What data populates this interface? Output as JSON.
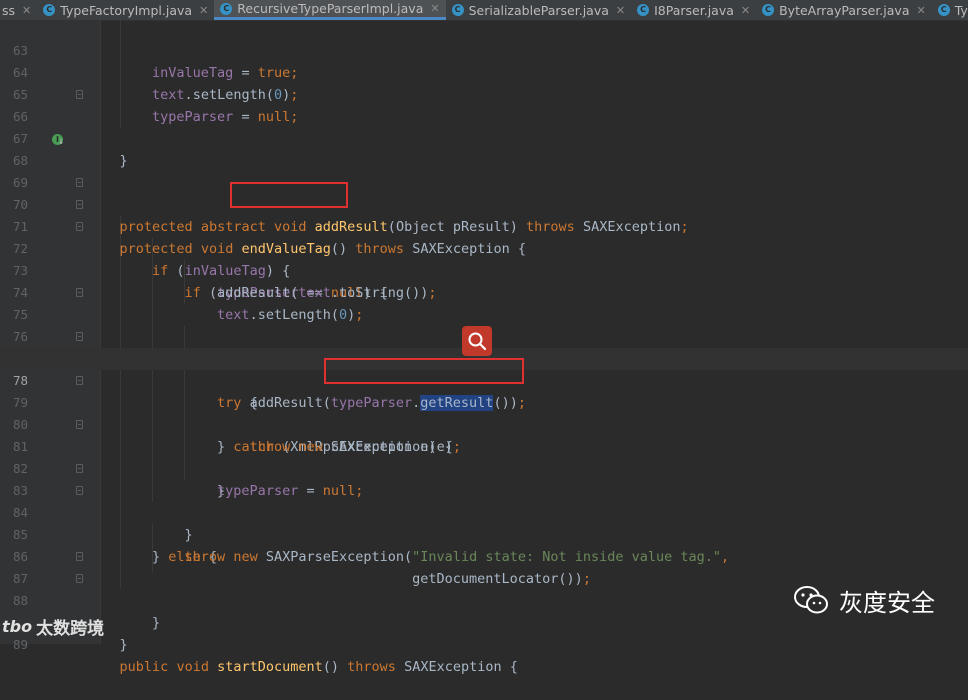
{
  "tabs": [
    {
      "label": "ss",
      "icon": "",
      "active": false
    },
    {
      "label": "TypeFactoryImpl.java",
      "icon": "C",
      "active": false
    },
    {
      "label": "RecursiveTypeParserImpl.java",
      "icon": "C",
      "active": true
    },
    {
      "label": "SerializableParser.java",
      "icon": "C",
      "active": false
    },
    {
      "label": "I8Parser.java",
      "icon": "C",
      "active": false
    },
    {
      "label": "ByteArrayParser.java",
      "icon": "C",
      "active": false
    },
    {
      "label": "TypeP",
      "icon": "C",
      "active": false
    }
  ],
  "editor": {
    "current_line": "78",
    "selected_text": "getResult",
    "lines": [
      {
        "num": "63"
      },
      {
        "num": "64"
      },
      {
        "num": "65"
      },
      {
        "num": "66"
      },
      {
        "num": "67"
      },
      {
        "num": "68"
      },
      {
        "num": "69"
      },
      {
        "num": "70"
      },
      {
        "num": "71"
      },
      {
        "num": "72"
      },
      {
        "num": "73"
      },
      {
        "num": "74"
      },
      {
        "num": "75"
      },
      {
        "num": "76"
      },
      {
        "num": "77"
      },
      {
        "num": "78"
      },
      {
        "num": "79"
      },
      {
        "num": "80"
      },
      {
        "num": "81"
      },
      {
        "num": "82"
      },
      {
        "num": "83"
      },
      {
        "num": "84"
      },
      {
        "num": "85"
      },
      {
        "num": "86"
      },
      {
        "num": "87"
      },
      {
        "num": "88"
      },
      {
        "num": "89"
      }
    ],
    "code": {
      "inValueTag": "inValueTag",
      "true": "true",
      "text": "text",
      "setLength": "setLength",
      "zero": "0",
      "typeParser": "typeParser",
      "null": "null",
      "protected": "protected",
      "abstract": "abstract",
      "void": "void",
      "addResult": "addResult",
      "Object": "Object",
      "pResult": "pResult",
      "throws": "throws",
      "SAXException": "SAXException",
      "endValueTag": "endValueTag",
      "if": "if",
      "toString": "toString",
      "else": "else",
      "endDocument": "endDocument",
      "try": "try",
      "getResult": "getResult",
      "catch": "catch",
      "XmlRpcException": "XmlRpcException",
      "e": "e",
      "throw": "throw",
      "new": "new",
      "SAXParseException": "SAXParseException",
      "invalid_state_string": "\"Invalid state: Not inside value tag.\"",
      "getDocumentLocator": "getDocumentLocator",
      "public": "public",
      "startDocument": "startDocument"
    }
  },
  "watermarks": {
    "left": "太数跨境",
    "left_logo": "tbo",
    "right": "灰度安全",
    "right_icon": "wechat-icon"
  },
  "colors": {
    "keyword": "#cc7832",
    "field": "#9876aa",
    "method": "#ffc66d",
    "number": "#6897bb",
    "string": "#6a8759",
    "highlight_box": "#e03030",
    "selection": "#214283"
  }
}
